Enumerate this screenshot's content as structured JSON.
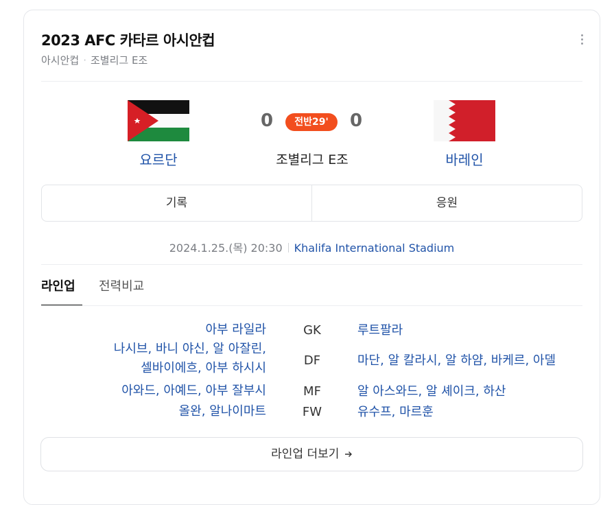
{
  "header": {
    "title": "2023 AFC 카타르 아시안컵",
    "breadcrumb_1": "아시안컵",
    "breadcrumb_2": "조별리그 E조"
  },
  "match": {
    "home_team": "요르단",
    "away_team": "바레인",
    "home_score": "0",
    "away_score": "0",
    "status": "전반29'",
    "group": "조별리그 E조",
    "datetime": "2024.1.25.(목) 20:30",
    "venue": "Khalifa International Stadium"
  },
  "tabs": {
    "record": "기록",
    "cheer": "응원"
  },
  "lineup_tabs": {
    "lineup": "라인업",
    "compare": "전력비교"
  },
  "lineup": [
    {
      "pos": "GK",
      "home_1": "아부 라일라",
      "home_2": "",
      "away": "루트팔라"
    },
    {
      "pos": "DF",
      "home_1": "나시브, 바니 야신, 알 아잘린,",
      "home_2": "셀바이에흐, 아부 하시시",
      "away": "마단, 알 칼라시, 알 하얌, 바케르, 아델"
    },
    {
      "pos": "MF",
      "home_1": "아와드, 아예드, 아부 잘부시",
      "home_2": "",
      "away": "알 아스와드, 알 셰이크, 하산"
    },
    {
      "pos": "FW",
      "home_1": "올완, 알나이마트",
      "home_2": "",
      "away": "유수프, 마르훈"
    }
  ],
  "more_button": "라인업 더보기",
  "colors": {
    "accent_blue": "#2053a8",
    "live_red": "#f24e1e"
  },
  "icons": {
    "menu": "more-vertical-icon",
    "arrow": "arrow-right-icon"
  }
}
